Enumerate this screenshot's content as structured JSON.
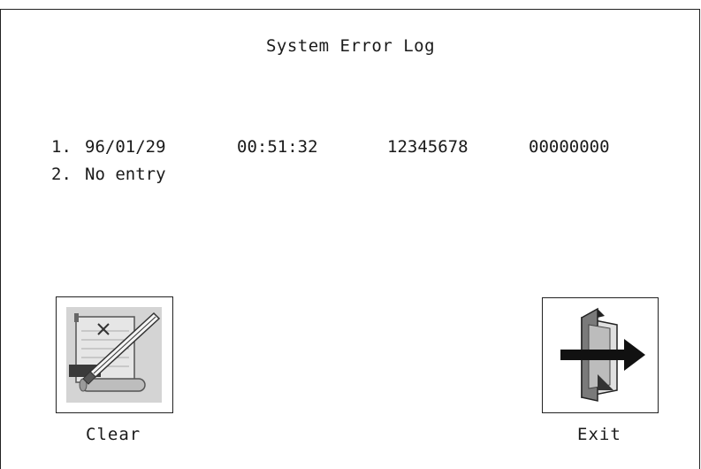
{
  "window": {
    "title": "System Error Log"
  },
  "log": {
    "entries": [
      {
        "index": "1.",
        "date": "96/01/29",
        "time": "00:51:32",
        "code1": "12345678",
        "code2": "00000000"
      },
      {
        "index": "2.",
        "text": "No entry"
      }
    ]
  },
  "buttons": {
    "clear": {
      "label": "Clear",
      "icon": "clear-log-icon"
    },
    "exit": {
      "label": "Exit",
      "icon": "exit-door-icon"
    }
  }
}
